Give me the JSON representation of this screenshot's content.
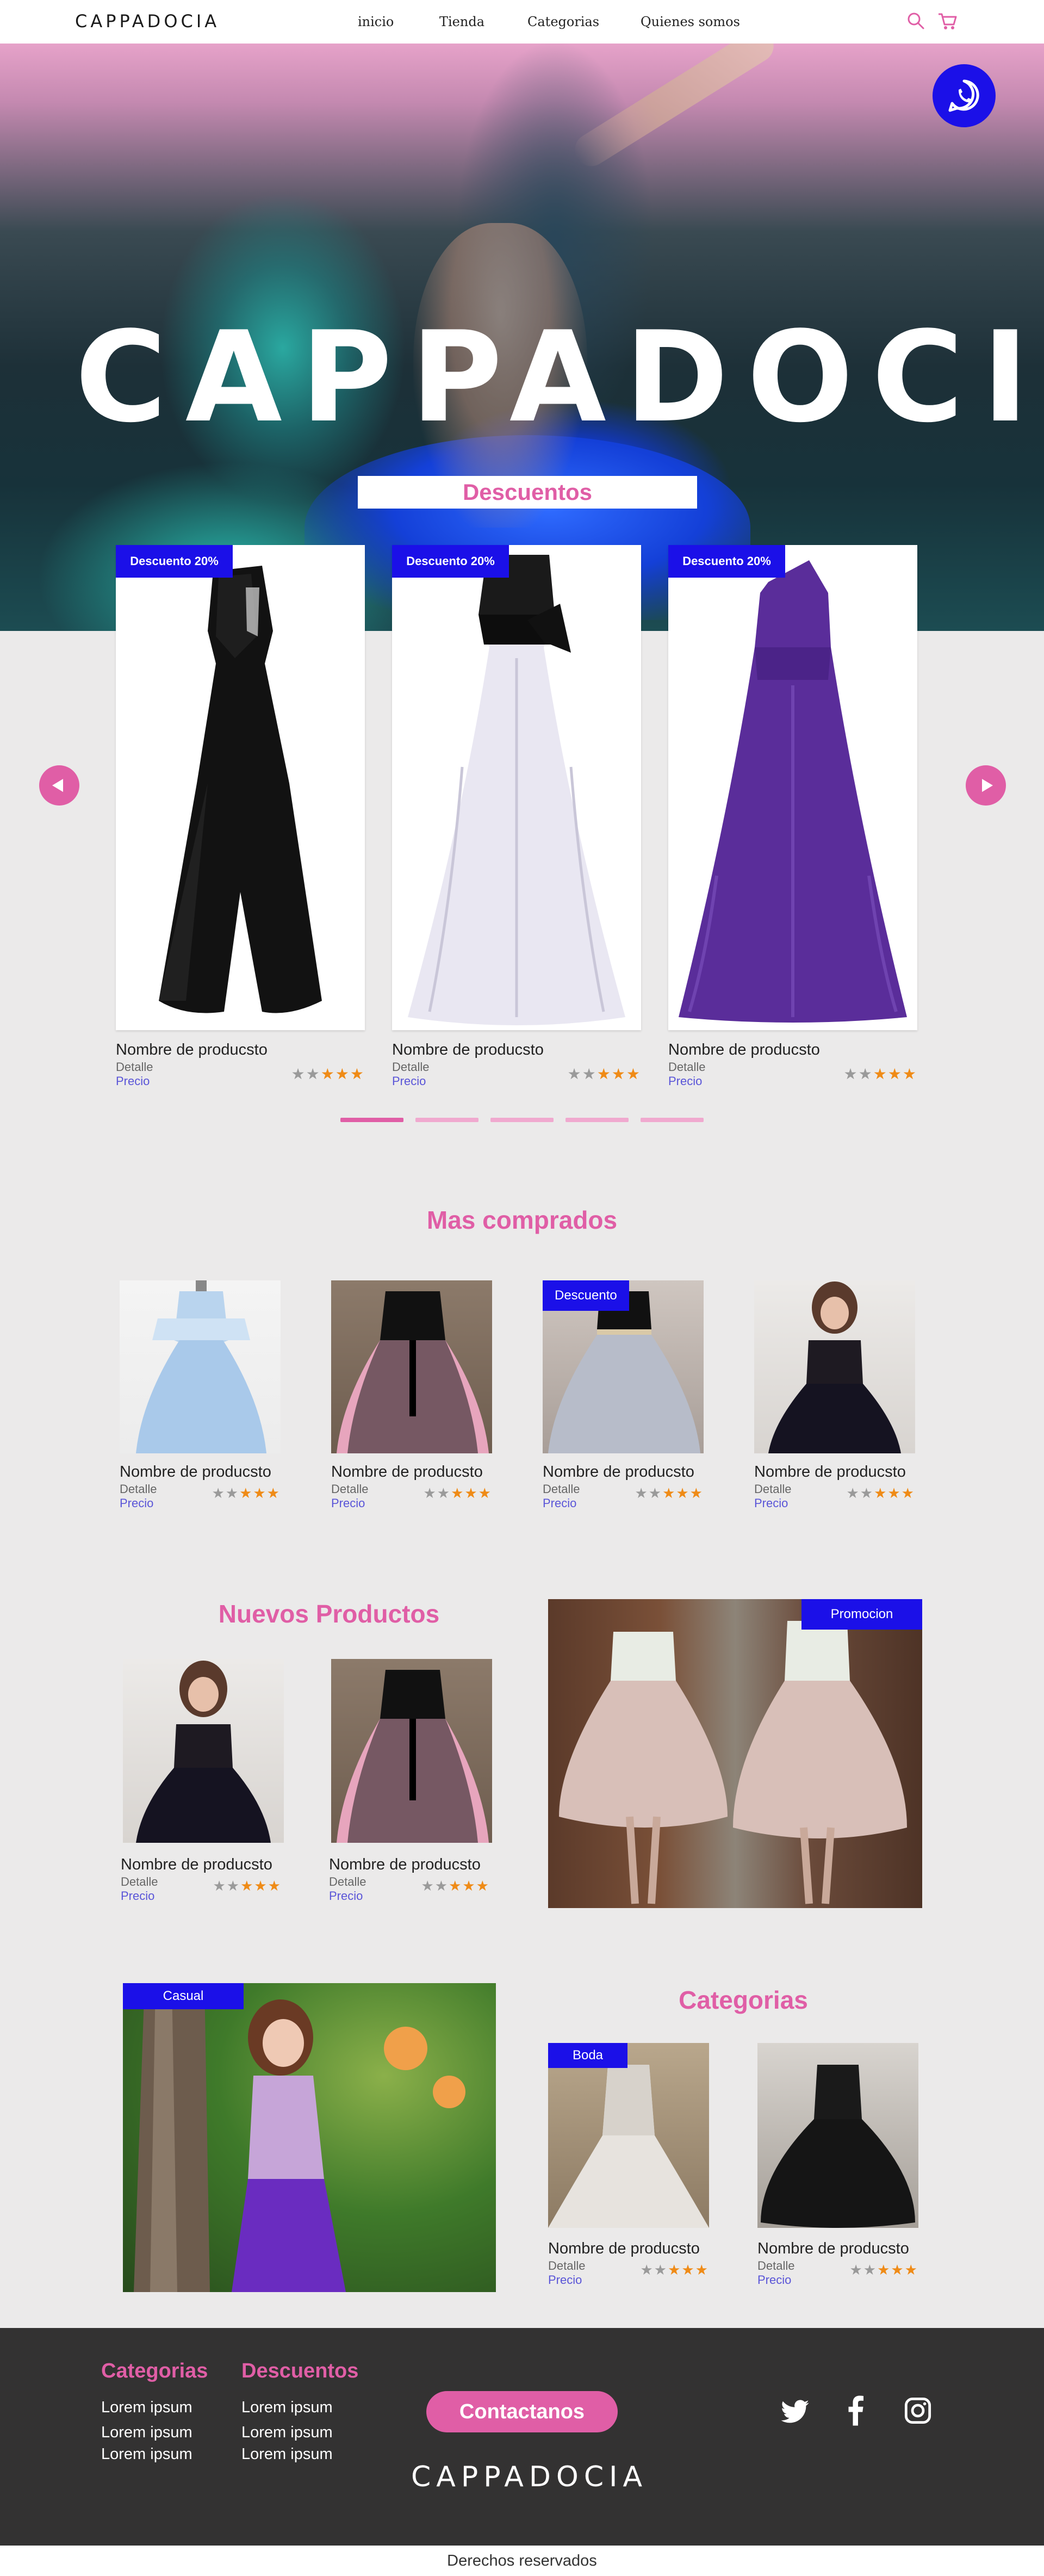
{
  "nav": {
    "logo": "CAPPADOCIA",
    "links": [
      "inicio",
      "Tienda",
      "Categorias",
      "Quienes somos"
    ],
    "icons": [
      "search-icon",
      "cart-icon"
    ]
  },
  "hero": {
    "title": "CAPPADOCIA"
  },
  "whatsapp": {
    "icon": "whatsapp-icon"
  },
  "discounts": {
    "title": "Descuentos",
    "products": [
      {
        "badge": "Descuento 20%",
        "name": "Nombre de producsto",
        "detail": "Detalle",
        "price": "Precio",
        "rating": 3
      },
      {
        "badge": "Descuento 20%",
        "name": "Nombre de producsto",
        "detail": "Detalle",
        "price": "Precio",
        "rating": 3
      },
      {
        "badge": "Descuento 20%",
        "name": "Nombre de producsto",
        "detail": "Detalle",
        "price": "Precio",
        "rating": 3
      }
    ],
    "carousel_pages": 5,
    "active_page": 1
  },
  "most_bought": {
    "title": "Mas comprados",
    "products": [
      {
        "badge": "",
        "name": "Nombre de producsto",
        "detail": "Detalle",
        "price": "Precio",
        "rating": 3
      },
      {
        "badge": "",
        "name": "Nombre de producsto",
        "detail": "Detalle",
        "price": "Precio",
        "rating": 3
      },
      {
        "badge": "Descuento",
        "name": "Nombre de producsto",
        "detail": "Detalle",
        "price": "Precio",
        "rating": 3
      },
      {
        "badge": "",
        "name": "Nombre de producsto",
        "detail": "Detalle",
        "price": "Precio",
        "rating": 3
      }
    ]
  },
  "new_products": {
    "title": "Nuevos Productos",
    "products": [
      {
        "name": "Nombre de producsto",
        "detail": "Detalle",
        "price": "Precio",
        "rating": 3
      },
      {
        "name": "Nombre de producsto",
        "detail": "Detalle",
        "price": "Precio",
        "rating": 3
      }
    ],
    "promo_badge": "Promocion"
  },
  "categories": {
    "title": "Categorias",
    "feature_badge": "Casual",
    "products": [
      {
        "badge": "Boda",
        "name": "Nombre de producsto",
        "detail": "Detalle",
        "price": "Precio",
        "rating": 3
      },
      {
        "badge": "",
        "name": "Nombre de producsto",
        "detail": "Detalle",
        "price": "Precio",
        "rating": 3
      }
    ]
  },
  "footer": {
    "col1": {
      "title": "Categorias",
      "items": [
        "Lorem ipsum",
        "Lorem ipsum",
        "Lorem ipsum"
      ]
    },
    "col2": {
      "title": "Descuentos",
      "items": [
        "Lorem ipsum",
        "Lorem ipsum",
        "Lorem ipsum"
      ]
    },
    "contact": "Contactanos",
    "logo": "CAPPADOCIA",
    "social": [
      "twitter-icon",
      "facebook-icon",
      "instagram-icon"
    ],
    "copyright": "Derechos reservados"
  },
  "colors": {
    "accent": "#e05ea6",
    "badge": "#1b10e8",
    "footer": "#333232",
    "star": "#ef8b17"
  }
}
